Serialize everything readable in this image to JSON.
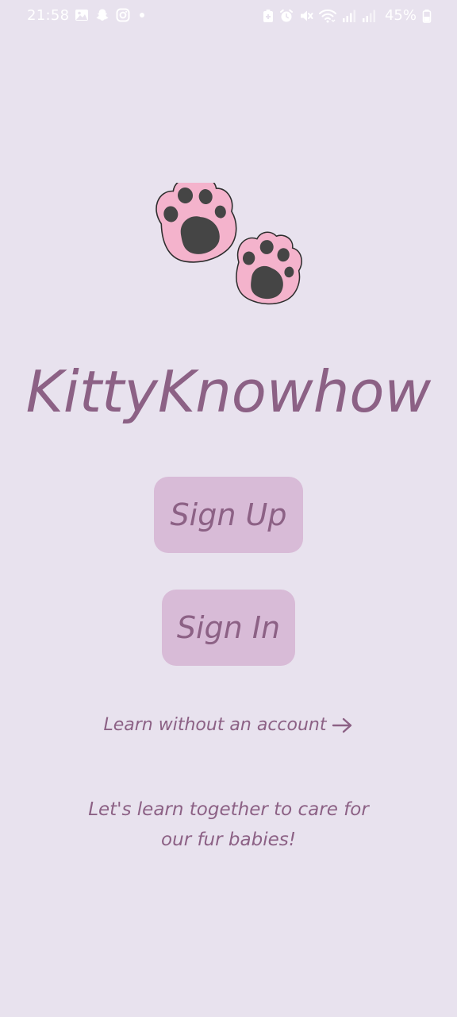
{
  "status_bar": {
    "time": "21:58",
    "battery": "45%",
    "left_icons": [
      "gallery-icon",
      "snapchat-icon",
      "instagram-icon",
      "dot-icon"
    ],
    "right_icons": [
      "battery-saver-icon",
      "alarm-icon",
      "mute-icon",
      "wifi-icon",
      "signal-icon",
      "signal-icon-2",
      "battery-icon"
    ]
  },
  "app": {
    "title": "KittyKnowhow",
    "logo_icon": "paw-prints-icon"
  },
  "buttons": {
    "sign_up": "Sign Up",
    "sign_in": "Sign In"
  },
  "learn_link": {
    "label": "Learn without an account",
    "icon": "arrow-right-icon"
  },
  "tagline": {
    "line1": "Let's learn together to care for",
    "line2": "our fur babies!"
  },
  "colors": {
    "background": "#E8E2EE",
    "button": "#D8BBD7",
    "text": "#8C6185",
    "paw_pink": "#F4B3CC",
    "paw_dark": "#454545"
  }
}
